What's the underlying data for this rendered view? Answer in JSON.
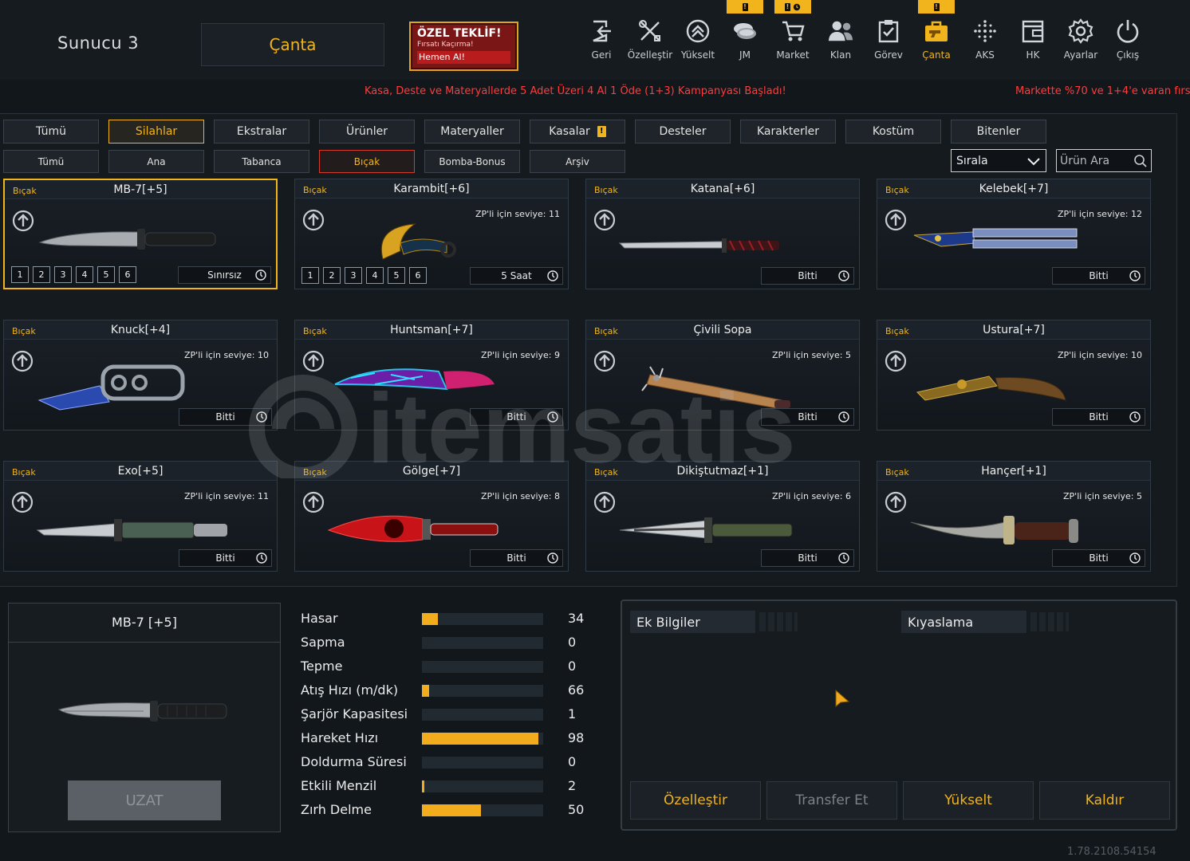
{
  "header": {
    "server": "Sunucu 3",
    "bag_title": "Çanta",
    "offer": {
      "title": "ÖZEL TEKLİF!",
      "subtitle": "Fırsatı Kaçırma!",
      "cta": "Hemen Al!"
    }
  },
  "nav": [
    {
      "label": "Geri",
      "icon": "exit-icon"
    },
    {
      "label": "Özelleştir",
      "icon": "tools-icon"
    },
    {
      "label": "Yükselt",
      "icon": "upgrade-icon"
    },
    {
      "label": "JM",
      "icon": "coins-icon",
      "badge": "!"
    },
    {
      "label": "Market",
      "icon": "cart-icon",
      "badge": "! clock"
    },
    {
      "label": "Klan",
      "icon": "clan-icon"
    },
    {
      "label": "Görev",
      "icon": "mission-icon"
    },
    {
      "label": "Çanta",
      "icon": "bag-icon",
      "badge": "!",
      "active": true
    },
    {
      "label": "AKS",
      "icon": "crosshair-icon"
    },
    {
      "label": "HK",
      "icon": "wallet-icon"
    },
    {
      "label": "Ayarlar",
      "icon": "gear-icon"
    },
    {
      "label": "Çıkış",
      "icon": "power-icon"
    }
  ],
  "ticker": {
    "message1": "Kasa, Deste ve Materyallerde 5 Adet Üzeri 4 Al 1 Öde (1+3) Kampanyası Başladı!",
    "message2": "Markette %70 ve 1+4'e varan fırsat"
  },
  "tabs": [
    "Tümü",
    "Silahlar",
    "Ekstralar",
    "Ürünler",
    "Materyaller",
    "Kasalar",
    "Desteler",
    "Karakterler",
    "Kostüm",
    "Bitenler"
  ],
  "active_tab": "Silahlar",
  "subtabs": [
    "Tümü",
    "Ana",
    "Tabanca",
    "Bıçak",
    "Bomba-Bonus",
    "Arşiv"
  ],
  "active_subtab": "Bıçak",
  "sort": {
    "label": "Sırala"
  },
  "search": {
    "placeholder": "Ürün Ara"
  },
  "items": [
    {
      "category": "Bıçak",
      "name": "MB-7[+5]",
      "level": "",
      "duration": "Sınırsız",
      "slots": [
        "1",
        "2",
        "3",
        "4",
        "5",
        "6"
      ],
      "selected": true,
      "weapon": "combat-knife"
    },
    {
      "category": "Bıçak",
      "name": "Karambit[+6]",
      "level": "ZP'li için seviye: 11",
      "duration": "5 Saat",
      "slots": [
        "1",
        "2",
        "3",
        "4",
        "5",
        "6"
      ],
      "weapon": "karambit"
    },
    {
      "category": "Bıçak",
      "name": "Katana[+6]",
      "level": "",
      "duration": "Bitti",
      "weapon": "katana"
    },
    {
      "category": "Bıçak",
      "name": "Kelebek[+7]",
      "level": "ZP'li için seviye: 12",
      "duration": "Bitti",
      "weapon": "butterfly"
    },
    {
      "category": "Bıçak",
      "name": "Knuck[+4]",
      "level": "ZP'li için seviye: 10",
      "duration": "Bitti",
      "weapon": "knuckle"
    },
    {
      "category": "Bıçak",
      "name": "Huntsman[+7]",
      "level": "ZP'li için seviye: 9",
      "duration": "Bitti",
      "weapon": "huntsman"
    },
    {
      "category": "Bıçak",
      "name": "Çivili Sopa",
      "level": "ZP'li için seviye: 5",
      "duration": "Bitti",
      "weapon": "bat"
    },
    {
      "category": "Bıçak",
      "name": "Ustura[+7]",
      "level": "ZP'li için seviye: 10",
      "duration": "Bitti",
      "weapon": "razor"
    },
    {
      "category": "Bıçak",
      "name": "Exo[+5]",
      "level": "ZP'li için seviye: 11",
      "duration": "Bitti",
      "weapon": "exo"
    },
    {
      "category": "Bıçak",
      "name": "Gölge[+7]",
      "level": "ZP'li için seviye: 8",
      "duration": "Bitti",
      "weapon": "shadow"
    },
    {
      "category": "Bıçak",
      "name": "Dikiştutmaz[+1]",
      "level": "ZP'li için seviye: 6",
      "duration": "Bitti",
      "weapon": "dagger-green"
    },
    {
      "category": "Bıçak",
      "name": "Hançer[+1]",
      "level": "ZP'li için seviye: 5",
      "duration": "Bitti",
      "weapon": "hancer"
    }
  ],
  "watermark": "itemsatis",
  "preview": {
    "title": "MB-7 [+5]",
    "extend_button": "UZAT"
  },
  "stats": [
    {
      "label": "Hasar",
      "value": "34",
      "fill": 0.13
    },
    {
      "label": "Sapma",
      "value": "0",
      "fill": 0
    },
    {
      "label": "Tepme",
      "value": "0",
      "fill": 0
    },
    {
      "label": "Atış Hızı (m/dk)",
      "value": "66",
      "fill": 0.06
    },
    {
      "label": "Şarjör Kapasitesi",
      "value": "1",
      "fill": 0
    },
    {
      "label": "Hareket Hızı",
      "value": "98",
      "fill": 0.96
    },
    {
      "label": "Doldurma Süresi",
      "value": "0",
      "fill": 0
    },
    {
      "label": "Etkili Menzil",
      "value": "2",
      "fill": 0.02
    },
    {
      "label": "Zırh Delme",
      "value": "50",
      "fill": 0.49
    }
  ],
  "info": {
    "extra": "Ek Bilgiler",
    "compare": "Kıyaslama"
  },
  "actions": [
    "Özelleştir",
    "Transfer Et",
    "Yükselt",
    "Kaldır"
  ],
  "version": "1.78.2108.54154",
  "colors": {
    "accent": "#f1b41c",
    "ticker": "#ff3b3b",
    "background": "#12171c"
  }
}
